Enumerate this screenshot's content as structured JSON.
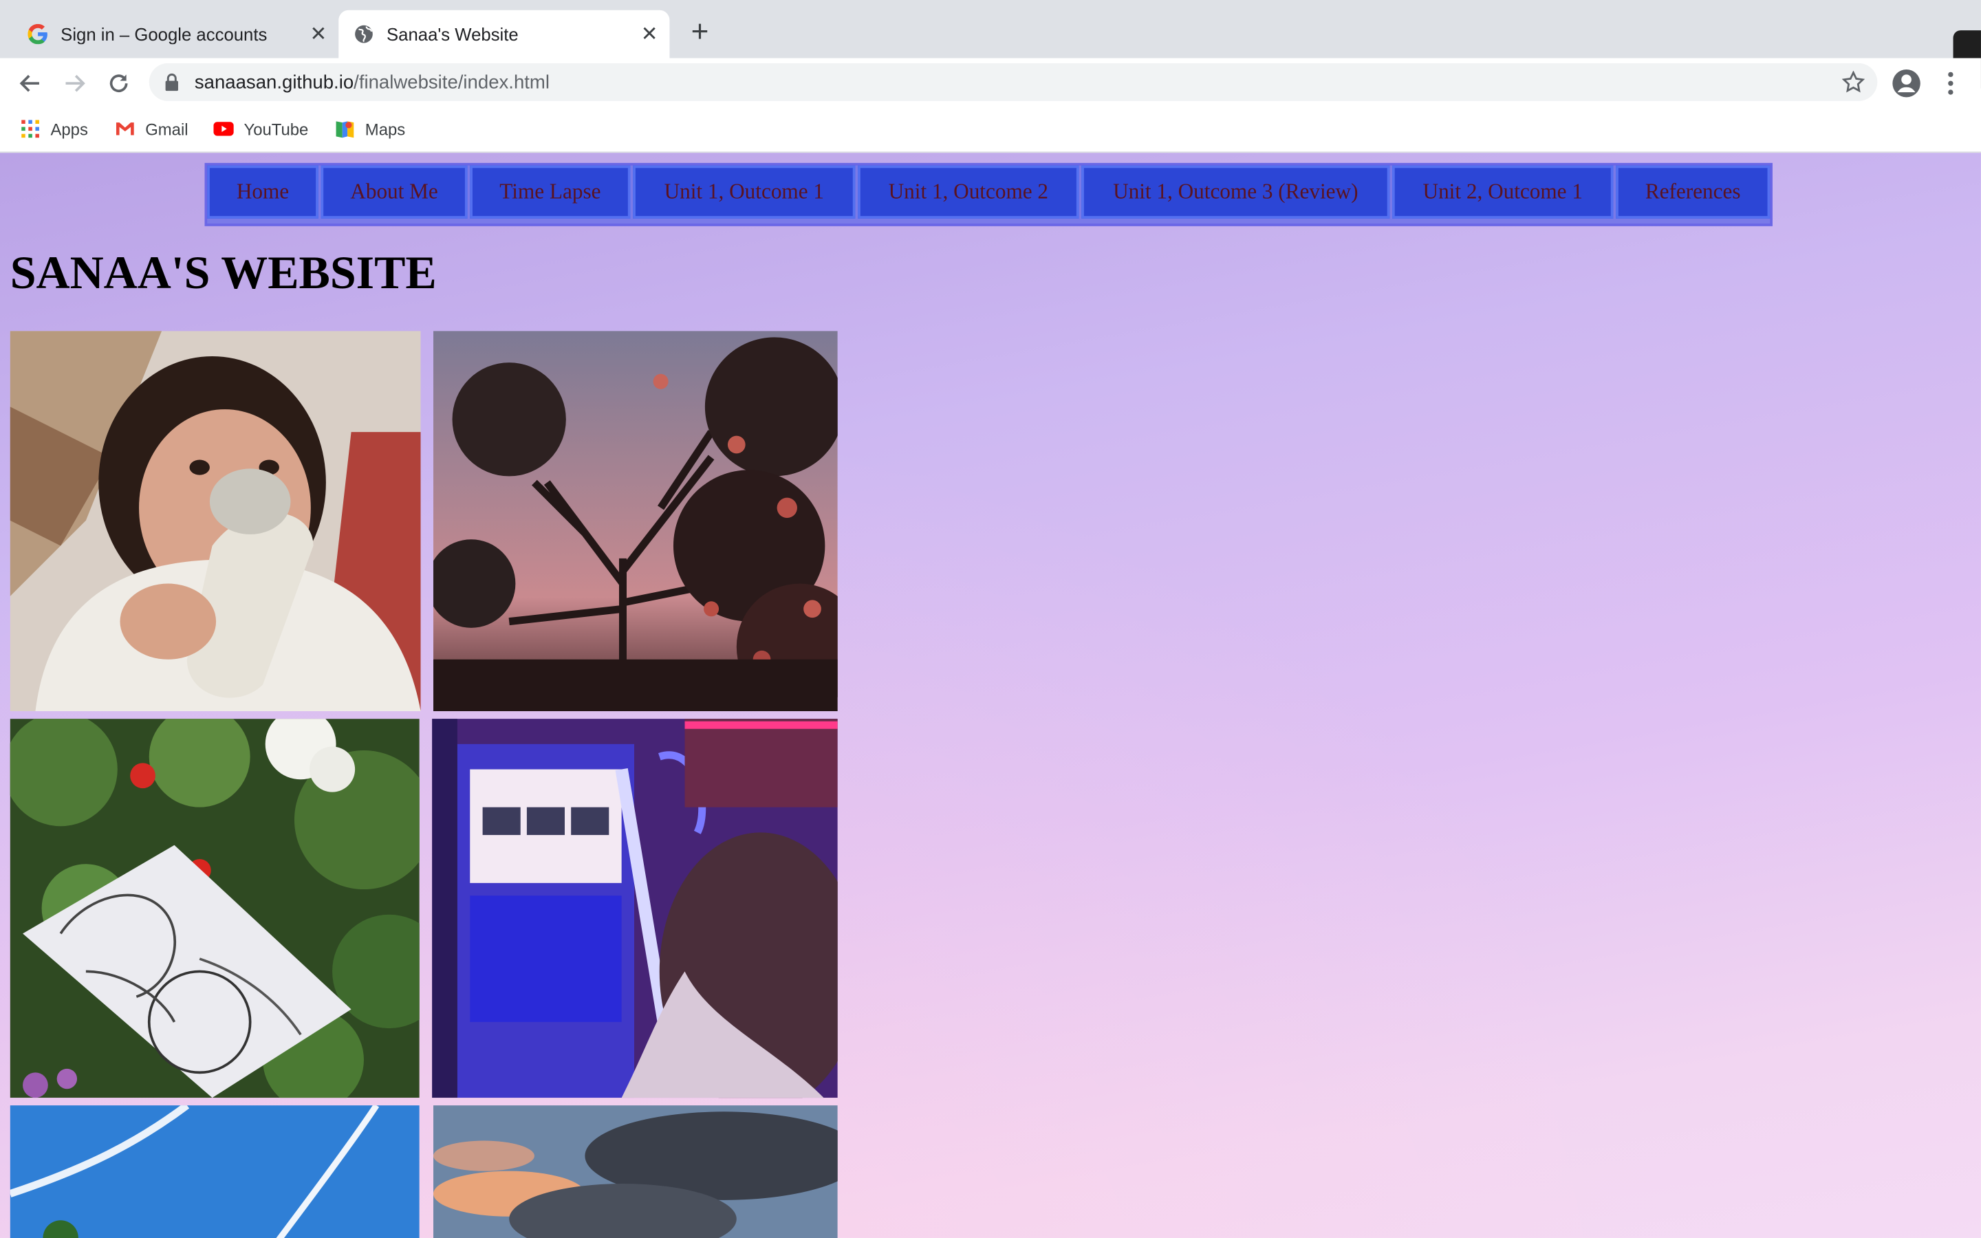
{
  "browser": {
    "tabs": [
      {
        "title": "Sign in – Google accounts",
        "active": false
      },
      {
        "title": "Sanaa's Website",
        "active": true
      }
    ],
    "url_host": "sanaasan.github.io",
    "url_path": "/finalwebsite/index.html",
    "bookmarks": [
      {
        "label": "Apps",
        "icon": "apps-grid-icon"
      },
      {
        "label": "Gmail",
        "icon": "gmail-icon"
      },
      {
        "label": "YouTube",
        "icon": "youtube-icon"
      },
      {
        "label": "Maps",
        "icon": "maps-icon"
      }
    ]
  },
  "site": {
    "nav": [
      "Home",
      "About Me",
      "Time Lapse",
      "Unit 1, Outcome 1",
      "Unit 1, Outcome 2",
      "Unit 1, Outcome 3 (Review)",
      "Unit 2, Outcome 1",
      "References"
    ],
    "title": "SANAA'S WEBSITE"
  },
  "colors": {
    "nav_bg": "#2c46d6",
    "nav_text": "#5a1320",
    "page_bg_top": "#b9a2e6",
    "page_bg_bottom": "#f4dbf4"
  }
}
